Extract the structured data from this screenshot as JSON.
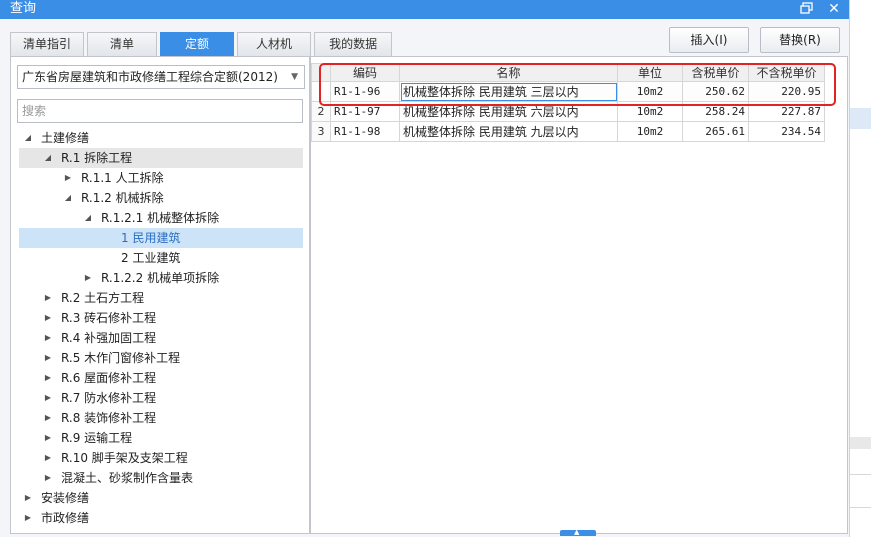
{
  "window": {
    "title": "查询"
  },
  "tabs": [
    {
      "label": "清单指引",
      "active": false
    },
    {
      "label": "清单",
      "active": false
    },
    {
      "label": "定额",
      "active": true
    },
    {
      "label": "人材机",
      "active": false
    },
    {
      "label": "我的数据",
      "active": false
    }
  ],
  "actions": {
    "insert_label": "插入(I)",
    "replace_label": "替换(R)"
  },
  "quota_select": {
    "value": "广东省房屋建筑和市政修缮工程综合定额(2012)"
  },
  "search": {
    "placeholder": "搜索"
  },
  "tree": [
    {
      "label": "土建修缮"
    },
    {
      "label": "R.1 拆除工程"
    },
    {
      "label": "R.1.1 人工拆除"
    },
    {
      "label": "R.1.2 机械拆除"
    },
    {
      "label": "R.1.2.1 机械整体拆除"
    },
    {
      "label": "1 民用建筑"
    },
    {
      "label": "2 工业建筑"
    },
    {
      "label": "R.1.2.2 机械单项拆除"
    },
    {
      "label": "R.2 土石方工程"
    },
    {
      "label": "R.3 砖石修补工程"
    },
    {
      "label": "R.4 补强加固工程"
    },
    {
      "label": "R.5 木作门窗修补工程"
    },
    {
      "label": "R.6 屋面修补工程"
    },
    {
      "label": "R.7 防水修补工程"
    },
    {
      "label": "R.8 装饰修补工程"
    },
    {
      "label": "R.9 运输工程"
    },
    {
      "label": "R.10 脚手架及支架工程"
    },
    {
      "label": "混凝土、砂浆制作含量表"
    },
    {
      "label": "安装修缮"
    },
    {
      "label": "市政修缮"
    }
  ],
  "table": {
    "headers": {
      "code": "编码",
      "name": "名称",
      "unit": "单位",
      "tax_price": "含税单价",
      "notax_price": "不含税单价"
    },
    "rows": [
      {
        "index": "",
        "code": "R1-1-96",
        "name": "机械整体拆除 民用建筑 三层以内",
        "unit": "10m2",
        "tax_price": "250.62",
        "notax_price": "220.95"
      },
      {
        "index": "2",
        "code": "R1-1-97",
        "name": "机械整体拆除 民用建筑 六层以内",
        "unit": "10m2",
        "tax_price": "258.24",
        "notax_price": "227.87"
      },
      {
        "index": "3",
        "code": "R1-1-98",
        "name": "机械整体拆除 民用建筑 九层以内",
        "unit": "10m2",
        "tax_price": "265.61",
        "notax_price": "234.54"
      }
    ]
  },
  "colors": {
    "accent": "#3a8ee6",
    "highlight": "#e02424",
    "tree_selected": "#cde3f7"
  }
}
